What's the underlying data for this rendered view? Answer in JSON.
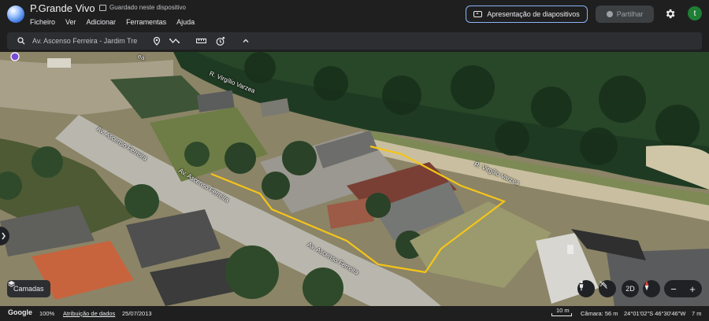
{
  "app": {
    "title": "P.Grande Vivo",
    "saved_status": "Guardado neste dispositivo",
    "avatar_letter": "t"
  },
  "menu": {
    "items": [
      "Ficheiro",
      "Ver",
      "Adicionar",
      "Ferramentas",
      "Ajuda"
    ]
  },
  "header": {
    "present_label": "Apresentação de diapositivos",
    "share_label": "Partilhar"
  },
  "search": {
    "value": "Av. Ascenso Ferreira - Jardim Tre"
  },
  "streets": {
    "virgilio_top": "R. Virgílio Varzea",
    "virgilio_right": "R. Virgílio Varzea",
    "ascenso_1": "Av. Ascenso Ferreira",
    "ascenso_2": "Av. Ascenso Ferreira",
    "ascenso_3": "Av. Ascenso Ferreira",
    "cut_label": "ea"
  },
  "controls": {
    "layers_label": "Camadas",
    "view_2d_label": "2D",
    "zoom_out": "−",
    "zoom_in": "+"
  },
  "status": {
    "brand": "Google",
    "zoom": "100%",
    "attribution": "Atribuição de dados",
    "imagery_date": "25/07/2013",
    "scale_label": "10 m",
    "camera": "Câmara: 56 m",
    "coords": "24°01'02\"S 46°30'46\"W",
    "elevation": "7 m"
  },
  "colors": {
    "accent": "#8ab4f8",
    "boundary": "#f5c518",
    "avatar": "#1e7e34"
  },
  "icons": [
    "globe-logo",
    "save-icon",
    "present-icon",
    "person-icon",
    "gear-icon",
    "search-icon",
    "pin-icon",
    "path-icon",
    "ruler-icon",
    "history-icon",
    "chevron-up-icon",
    "layers-icon",
    "pegman-icon",
    "compass-icon",
    "tilt-icon"
  ]
}
